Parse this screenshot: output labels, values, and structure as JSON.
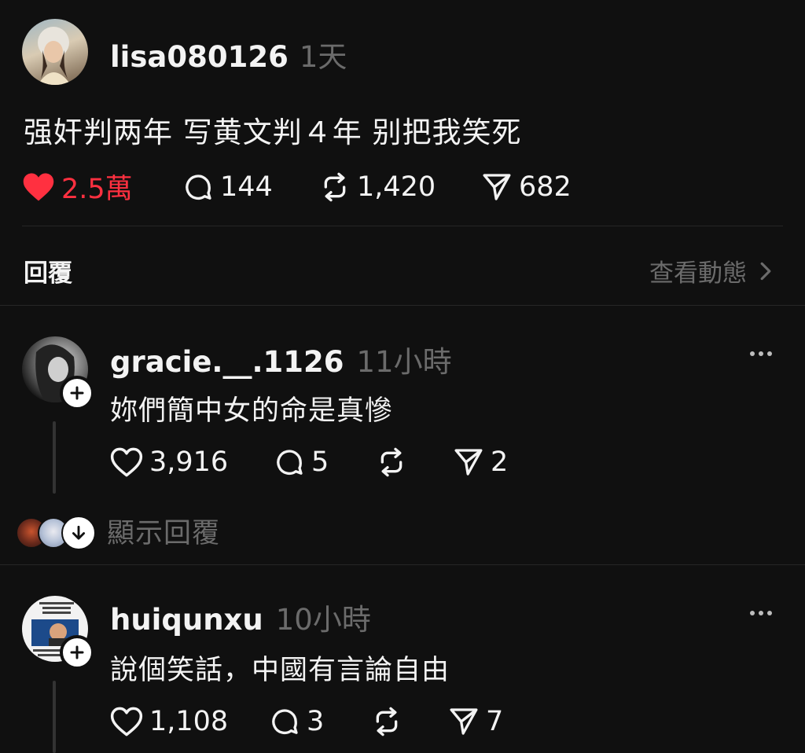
{
  "post": {
    "username": "lisa080126",
    "time": "1天",
    "text": "强奸判两年 写黄文判４年 别把我笑死",
    "likes": "2.5萬",
    "comments": "144",
    "reposts": "1,420",
    "shares": "682",
    "liked": true
  },
  "replies_section": {
    "label": "回覆",
    "view_activity": "查看動態"
  },
  "replies": [
    {
      "username": "gracie.__.1126",
      "time": "11小時",
      "text": "妳們簡中女的命是真慘",
      "likes": "3,916",
      "comments": "5",
      "reposts": "",
      "shares": "2",
      "show_replies": "顯示回覆"
    },
    {
      "username": "huiqunxu",
      "time": "10小時",
      "text": "說個笑話，中國有言論自由",
      "likes": "1,108",
      "comments": "3",
      "reposts": "",
      "shares": "7"
    }
  ],
  "colors": {
    "background": "#101010",
    "liked": "#ff3040",
    "secondary_text": "#6b6b6b",
    "divider": "#262626"
  }
}
